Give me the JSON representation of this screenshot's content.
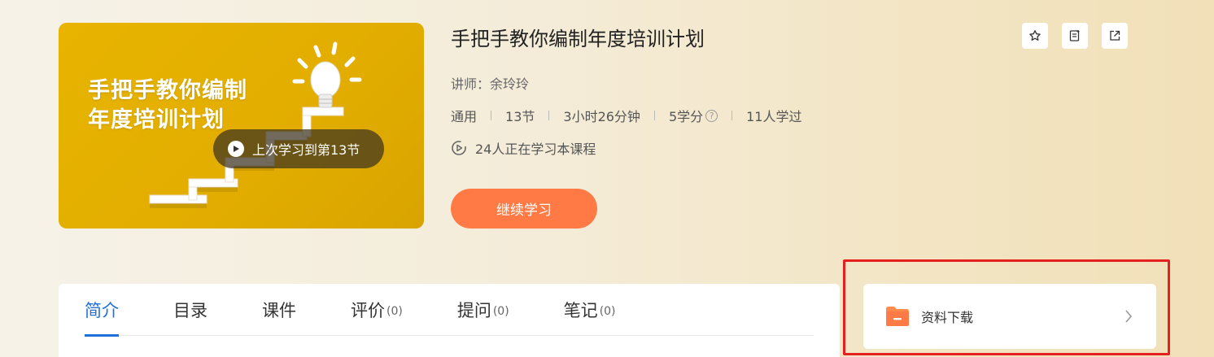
{
  "cover": {
    "title": "手把手教你编制\n年度培训计划",
    "resume_label": "上次学习到第13节"
  },
  "course": {
    "title": "手把手教你编制年度培训计划",
    "teacher": "讲师：余玲玲",
    "meta": {
      "category": "通用",
      "lessons": "13节",
      "duration": "3小时26分钟",
      "credits": "5学分",
      "learners": "11人学过"
    },
    "learning_now": "24人正在学习本课程",
    "continue_label": "继续学习"
  },
  "actions": {
    "icons": [
      "star-icon",
      "note-icon",
      "share-icon"
    ]
  },
  "tabs": [
    {
      "label": "简介",
      "count": ""
    },
    {
      "label": "目录",
      "count": ""
    },
    {
      "label": "课件",
      "count": ""
    },
    {
      "label": "评价",
      "count": "(0)"
    },
    {
      "label": "提问",
      "count": "(0)"
    },
    {
      "label": "笔记",
      "count": "(0)"
    }
  ],
  "download": {
    "label": "资料下载"
  },
  "colors": {
    "accent_orange": "#ff7a45",
    "tab_active": "#1f6fd8",
    "highlight_red": "#e5211f",
    "cover_yellow": "#e2ad00"
  }
}
